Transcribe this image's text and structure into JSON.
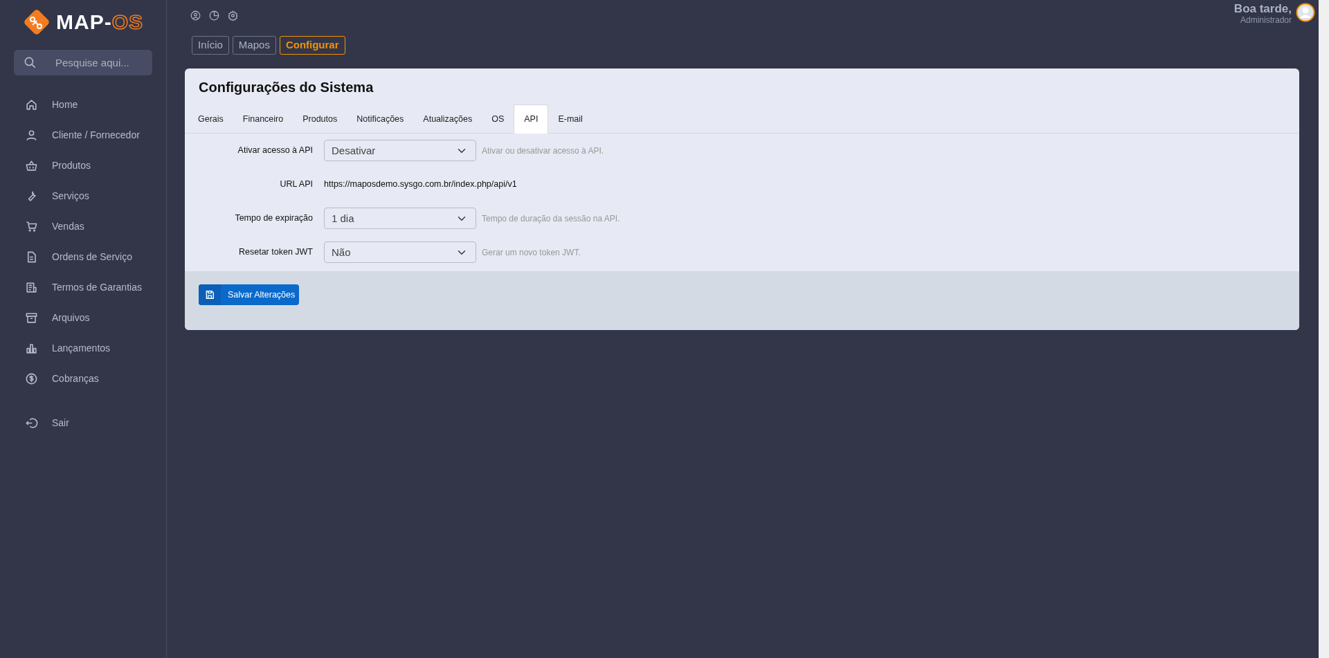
{
  "logo": {
    "text": "MAP-",
    "accent": "OS"
  },
  "search": {
    "placeholder": "Pesquise aqui..."
  },
  "sidebar": {
    "items": [
      {
        "label": "Home"
      },
      {
        "label": "Cliente / Fornecedor"
      },
      {
        "label": "Produtos"
      },
      {
        "label": "Serviços"
      },
      {
        "label": "Vendas"
      },
      {
        "label": "Ordens de Serviço"
      },
      {
        "label": "Termos de Garantias"
      },
      {
        "label": "Arquivos"
      },
      {
        "label": "Lançamentos"
      },
      {
        "label": "Cobranças"
      }
    ],
    "logout": {
      "label": "Sair"
    }
  },
  "header": {
    "greeting": "Boa tarde,",
    "user": "Administrador"
  },
  "breadcrumb": [
    {
      "label": "Início",
      "selected": false
    },
    {
      "label": "Mapos",
      "selected": false
    },
    {
      "label": "Configurar",
      "selected": true
    }
  ],
  "card": {
    "title": "Configurações do Sistema",
    "tabs": [
      {
        "label": "Gerais",
        "selected": false
      },
      {
        "label": "Financeiro",
        "selected": false
      },
      {
        "label": "Produtos",
        "selected": false
      },
      {
        "label": "Notificações",
        "selected": false
      },
      {
        "label": "Atualizações",
        "selected": false
      },
      {
        "label": "OS",
        "selected": false
      },
      {
        "label": "API",
        "selected": true
      },
      {
        "label": "E-mail",
        "selected": false
      }
    ],
    "fields": [
      {
        "kind": "select",
        "label": "Ativar acesso à API",
        "value": "Desativar",
        "help": "Ativar ou desativar acesso à API."
      },
      {
        "kind": "text",
        "label": "URL API",
        "value": "https://maposdemo.sysgo.com.br/index.php/api/v1"
      },
      {
        "kind": "select",
        "label": "Tempo de expiração",
        "value": "1 dia",
        "help": "Tempo de duração da sessão na API."
      },
      {
        "kind": "select",
        "label": "Resetar token JWT",
        "value": "Não",
        "help": "Gerar um novo token JWT."
      }
    ],
    "save_button": "Salvar Alterações"
  }
}
